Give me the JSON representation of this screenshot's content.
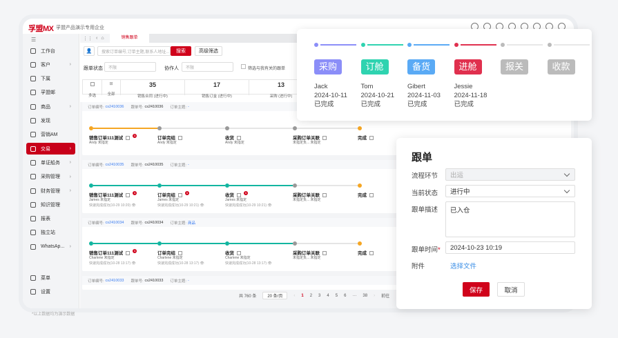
{
  "app": {
    "logo": "孚盟MX",
    "org": "孚盟产品演示专用企业"
  },
  "topbar_icons": [
    "chat-icon",
    "headset-icon",
    "currency-icon",
    "phone-icon",
    "list-icon",
    "bell-icon",
    "help-icon",
    "avatar-icon"
  ],
  "sidebar": {
    "items": [
      {
        "label": "工作台",
        "arrow": false
      },
      {
        "label": "客户",
        "arrow": true
      },
      {
        "label": "下属",
        "arrow": false
      },
      {
        "label": "孚盟邮",
        "arrow": false
      },
      {
        "label": "商品",
        "arrow": true
      },
      {
        "label": "发现",
        "arrow": false
      },
      {
        "label": "营销AM",
        "arrow": false
      },
      {
        "label": "交易",
        "arrow": true,
        "active": true
      },
      {
        "label": "单证船务",
        "arrow": true
      },
      {
        "label": "采购管理",
        "arrow": true
      },
      {
        "label": "财务管理",
        "arrow": true
      },
      {
        "label": "知识管理",
        "arrow": false
      },
      {
        "label": "报表",
        "arrow": false
      },
      {
        "label": "独立站",
        "arrow": false
      },
      {
        "label": "WhatsAp...",
        "arrow": true
      }
    ],
    "bottom": [
      {
        "label": "菜单"
      },
      {
        "label": "设置"
      }
    ]
  },
  "tabs": {
    "active": "销售跟单"
  },
  "search": {
    "placeholder": "搜索订单编号,订单主题,联系人地址...",
    "button": "搜索",
    "advanced": "高级筛选"
  },
  "filters": {
    "status_label": "跟单状态",
    "status_placeholder": "不限",
    "collab_label": "协作人",
    "collab_placeholder": "不限",
    "mine_label": "筛选与我有关的跟单"
  },
  "stats": {
    "multi": "多选",
    "all": "全部",
    "items": [
      {
        "count": "35",
        "label": "销售合同 (进行中)"
      },
      {
        "count": "17",
        "label": "销售订金 (进行中)"
      },
      {
        "count": "13",
        "label": "采购 (进行中)"
      }
    ]
  },
  "labels": {
    "order_no": "订单编号:",
    "track_no": "跟单号:",
    "subject": "订单主题:"
  },
  "orders": [
    {
      "order_no": "cs2410036",
      "track_no": "cs2410036",
      "subject": "-",
      "color": "#f5a623",
      "done": 1,
      "steps": [
        {
          "name": "销售订单111测试",
          "sub": "Andy 未指定",
          "badge": "1"
        },
        {
          "name": "订单完结",
          "sub": "Andy 未指定"
        },
        {
          "name": "收货",
          "sub": "Andy 未指定"
        },
        {
          "name": "采购订单关联",
          "sub": "未指定负...    未指定"
        },
        {
          "name": "完成",
          "sub": ""
        }
      ]
    },
    {
      "order_no": "cs2410035",
      "track_no": "cs2410035",
      "subject": "-",
      "color": "#12b5a0",
      "done": 3,
      "steps": [
        {
          "name": "销售订单111测试",
          "sub": "James 未指定",
          "time": "快速完成成功(10-29 10:20)",
          "badge": "1"
        },
        {
          "name": "订单完结",
          "sub": "James 未指定",
          "time": "快速完成成功(10-29 10:21)",
          "badge": "1"
        },
        {
          "name": "收货",
          "sub": "James 未指定",
          "time": "快速完成成功(10-29 10:21)",
          "badge": "1"
        },
        {
          "name": "采购订单关联",
          "sub": "未指定负...    未指定"
        },
        {
          "name": "完成",
          "sub": ""
        }
      ]
    },
    {
      "order_no": "cs2410034",
      "track_no": "cs2410034",
      "subject": "商品",
      "color": "#12b5a0",
      "done": 3,
      "steps": [
        {
          "name": "销售订单111测试",
          "sub": "Charlene 未指定",
          "time": "快速完成成功(10-28 13:17)",
          "badge": "1"
        },
        {
          "name": "订单完结",
          "sub": "Charlene 未指定",
          "time": "快速完成成功(10-28 13:17)"
        },
        {
          "name": "收货",
          "sub": "Charlene 未指定",
          "time": "快速完成成功(10-28 13:17)"
        },
        {
          "name": "采购订单关联",
          "sub": "未指定负...    未指定"
        },
        {
          "name": "完成",
          "sub": ""
        }
      ]
    },
    {
      "order_no": "cs2410033",
      "track_no": "cs2410033",
      "subject": "-"
    }
  ],
  "pagination": {
    "total": "共 760 条",
    "page_size": "20 条/页",
    "pages": [
      "1",
      "2",
      "3",
      "4",
      "5",
      "6",
      "···",
      "38"
    ],
    "current": "1",
    "goto": "前往"
  },
  "workflow": {
    "stages": [
      {
        "name": "采购",
        "color": "#8b8ef8",
        "person": "Jack",
        "date": "2024-10-11",
        "status": "已完成"
      },
      {
        "name": "订舱",
        "color": "#2fd3b0",
        "person": "Tom",
        "date": "2024-10-21",
        "status": "已完成"
      },
      {
        "name": "备货",
        "color": "#5aaaf5",
        "person": "Gibert",
        "date": "2024-11-03",
        "status": "已完成"
      },
      {
        "name": "进舱",
        "color": "#e0304e",
        "person": "Jessie",
        "date": "2024-11-18",
        "status": "已完成"
      },
      {
        "name": "报关",
        "color": "#bbbbbb"
      },
      {
        "name": "收款",
        "color": "#bbbbbb"
      }
    ]
  },
  "form": {
    "title": "跟单",
    "stage_label": "流程环节",
    "stage_value": "出运",
    "status_label": "当前状态",
    "status_value": "进行中",
    "desc_label": "跟单描述",
    "desc_value": "已入仓",
    "time_label": "跟单时间",
    "required": "*",
    "time_value": "2024-10-23 10:19",
    "attach_label": "附件",
    "attach_link": "选择文件",
    "save": "保存",
    "cancel": "取消"
  },
  "footnote": "*以上数据均为演示数据",
  "colors": {
    "brand": "#d0021b",
    "link": "#3a7cf0"
  }
}
